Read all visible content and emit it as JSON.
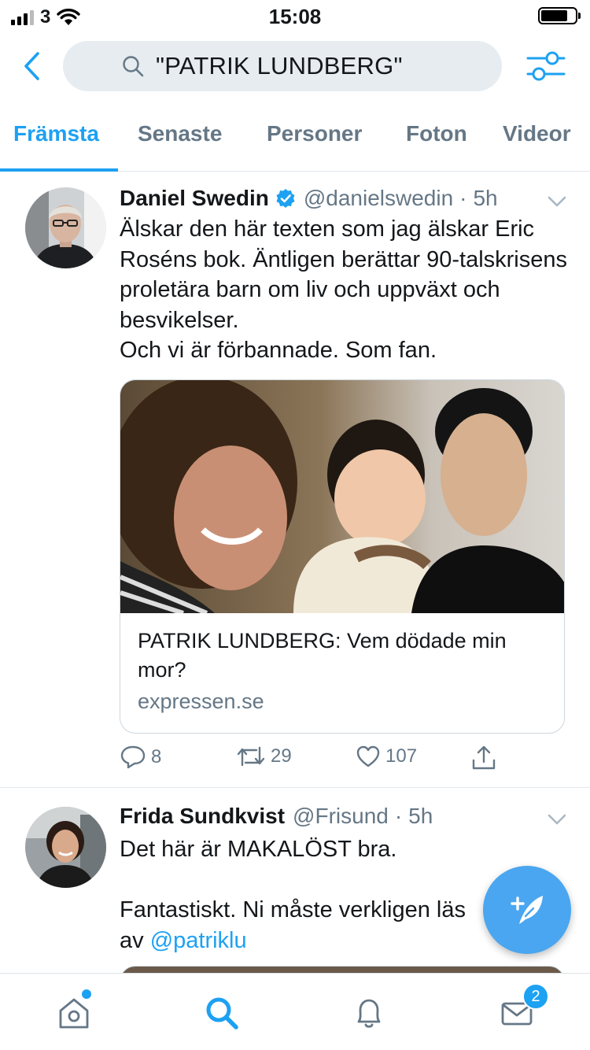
{
  "status_bar": {
    "carrier": "3",
    "time": "15:08"
  },
  "search": {
    "query": "\"PATRIK LUNDBERG\""
  },
  "tabs": [
    {
      "label": "Främsta",
      "active": true
    },
    {
      "label": "Senaste",
      "active": false
    },
    {
      "label": "Personer",
      "active": false
    },
    {
      "label": "Foton",
      "active": false
    },
    {
      "label": "Videor",
      "active": false
    }
  ],
  "tweets": [
    {
      "name": "Daniel Swedin",
      "verified": true,
      "handle": "@danielswedin",
      "time": "5h",
      "body": "Älskar den här texten som jag älskar Eric Roséns bok. Äntligen berättar 90-talskrisens proletära barn om liv och uppväxt och besvikelser.\nOch vi är förbannade. Som fan.",
      "card": {
        "title": "PATRIK LUNDBERG: Vem dödade min mor?",
        "domain": "expressen.se"
      },
      "replies": "8",
      "retweets": "29",
      "likes": "107"
    },
    {
      "name": "Frida Sundkvist",
      "verified": false,
      "handle": "@Frisund",
      "time": "5h",
      "body_text": "Det här är MAKALÖST bra.\n\nFantastiskt. Ni måste verkligen läs",
      "body_line_end": "av ",
      "mention": "@patriklu"
    }
  ],
  "tab_bar": {
    "notifications_badge": "2"
  },
  "colors": {
    "accent": "#1da1f2",
    "secondary_text": "#657786",
    "search_bg": "#e6ecf0",
    "fab": "#4aa6f0"
  }
}
